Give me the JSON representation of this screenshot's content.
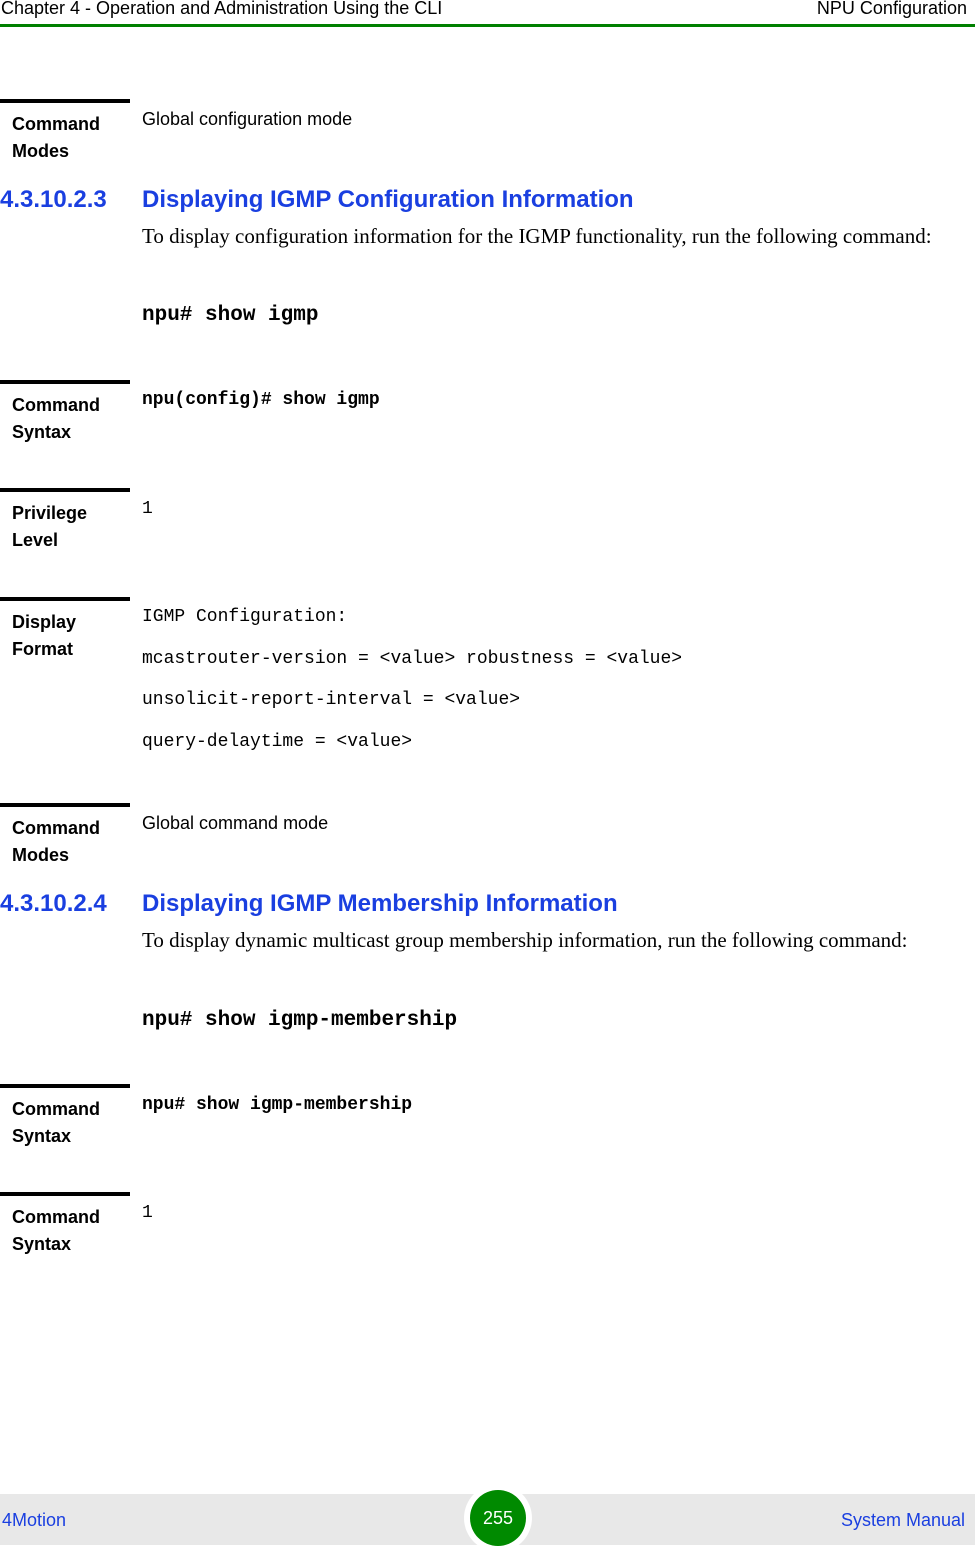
{
  "header": {
    "chapter_title": "Chapter 4 - Operation and Administration Using the CLI",
    "section_title": "NPU Configuration"
  },
  "blocks": {
    "modes_1": {
      "label_line1": "Command",
      "label_line2": "Modes",
      "value": "Global configuration mode"
    },
    "section_3": {
      "number": "4.3.10.2.3",
      "title": "Displaying IGMP Configuration Information",
      "intro": "To display configuration information for the IGMP functionality, run the following command:",
      "command": "npu# show igmp"
    },
    "syntax_3": {
      "label_line1": "Command",
      "label_line2": "Syntax",
      "value": "npu(config)# show igmp"
    },
    "privilege_3": {
      "label_line1": "Privilege",
      "label_line2": "Level",
      "value": "1"
    },
    "display_3": {
      "label_line1": "Display",
      "label_line2": "Format",
      "lines": [
        "IGMP Configuration:",
        "mcastrouter-version = <value> robustness = <value>",
        "unsolicit-report-interval = <value>",
        "query-delaytime = <value>"
      ]
    },
    "modes_3": {
      "label_line1": "Command",
      "label_line2": "Modes",
      "value": "Global command mode"
    },
    "section_4": {
      "number": "4.3.10.2.4",
      "title": "Displaying IGMP Membership Information",
      "intro": "To display dynamic multicast group membership information, run the following command:",
      "command": "npu# show igmp-membership"
    },
    "syntax_4": {
      "label_line1": "Command",
      "label_line2": "Syntax",
      "value": "npu# show igmp-membership"
    },
    "syntax_4b": {
      "label_line1": "Command",
      "label_line2": "Syntax",
      "value": "1"
    }
  },
  "footer": {
    "product": "4Motion",
    "page_number": "255",
    "manual": "System Manual"
  },
  "colors": {
    "accent_green": "#008000",
    "heading_blue": "#1a3fe0",
    "footer_bg": "#e8e8e8"
  }
}
